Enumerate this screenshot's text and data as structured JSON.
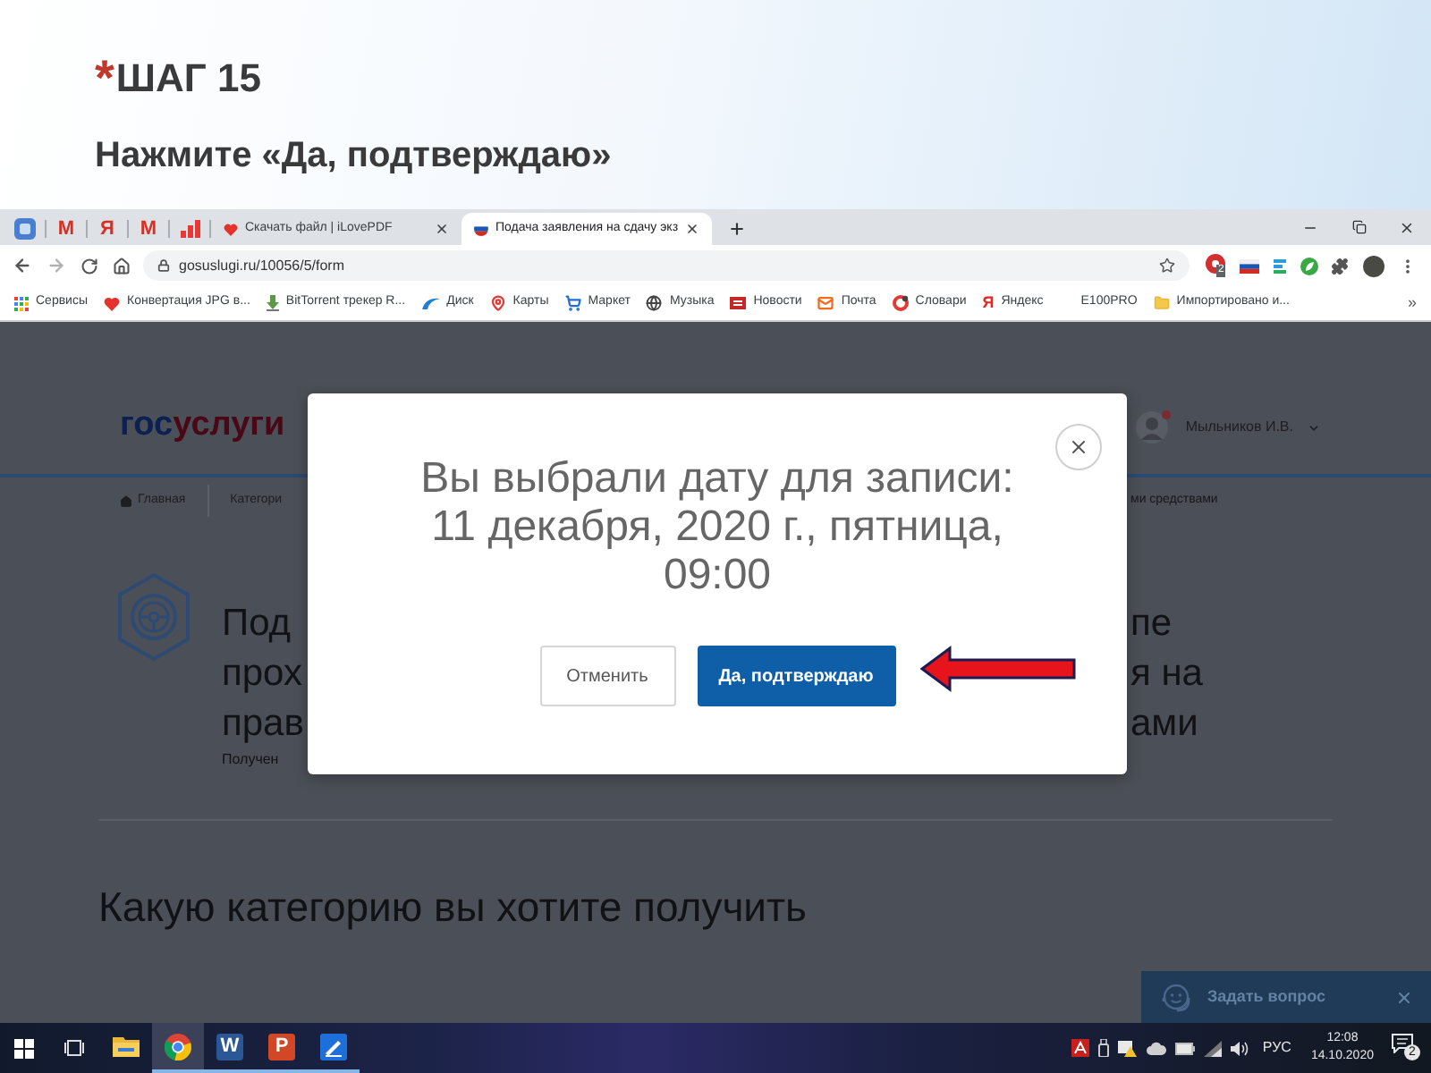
{
  "slide": {
    "marker": "*",
    "title": "ШАГ 15",
    "instruction": "Нажмите «Да, подтверждаю»"
  },
  "browser": {
    "pinned_tabs": [
      {
        "kind": "app"
      },
      {
        "kind": "glyph",
        "glyph": "M"
      },
      {
        "kind": "glyph",
        "glyph": "Я"
      },
      {
        "kind": "glyph",
        "glyph": "M"
      },
      {
        "kind": "chart"
      }
    ],
    "tabs": [
      {
        "kind": "heart",
        "title": "Скачать файл | iLovePDF",
        "selected": false
      },
      {
        "kind": "flag",
        "title": "Подача заявления на сдачу экз",
        "selected": true
      }
    ],
    "address": "gosuslugi.ru/10056/5/form",
    "extension_badge": "2",
    "bookmarks": [
      {
        "kind": "apps",
        "label": "Сервисы"
      },
      {
        "kind": "heart",
        "label": "Конвертация JPG в..."
      },
      {
        "kind": "torrent",
        "label": "BitTorrent трекер R..."
      },
      {
        "kind": "arc",
        "label": "Диск"
      },
      {
        "kind": "pin",
        "label": "Карты"
      },
      {
        "kind": "cart",
        "label": "Маркет"
      },
      {
        "kind": "globe",
        "label": "Музыка"
      },
      {
        "kind": "news",
        "label": "Новости"
      },
      {
        "kind": "mail",
        "label": "Почта"
      },
      {
        "kind": "round",
        "label": "Словари"
      },
      {
        "kind": "letter",
        "glyph": "Я",
        "label": "Яндекс"
      },
      {
        "kind": "blank",
        "label": "E100PRO"
      },
      {
        "kind": "folder",
        "label": "Импортировано и..."
      }
    ],
    "bookmarks_more": "»"
  },
  "page": {
    "logo": [
      {
        "text": "гос",
        "color": "#0c2152"
      },
      {
        "text": "услуги",
        "color": "#4a0816"
      }
    ],
    "user": "Мыльников И.В.",
    "breadcrumbs": [
      {
        "kind": "home",
        "label": "Главная"
      },
      {
        "kind": "plain",
        "label": "Категори"
      }
    ],
    "breadcrumb_tail": "ми средствами",
    "title_left": [
      "Под",
      "прох",
      "прав"
    ],
    "title_right": [
      "пе",
      "я на",
      "ами"
    ],
    "subtitle_left": "Получен",
    "section_heading": "Какую категорию вы хотите получить"
  },
  "modal": {
    "lines": [
      "Вы выбрали дату для записи:",
      "11 декабря, 2020 г., пятница,",
      "09:00"
    ],
    "buttons": [
      {
        "kind": "secondary",
        "label": "Отменить"
      },
      {
        "kind": "primary",
        "label": "Да, подтверждаю"
      }
    ]
  },
  "chat": {
    "label": "Задать вопрос"
  },
  "taskbar": {
    "apps": [
      {
        "kind": "folder",
        "selected": false,
        "running": false
      },
      {
        "kind": "browser",
        "selected": true,
        "running": true
      },
      {
        "kind": "tile",
        "glyph": "W",
        "color": "#2b5797",
        "selected": false,
        "running": true
      },
      {
        "kind": "tile",
        "glyph": "P",
        "color": "#d24726",
        "selected": false,
        "running": true
      },
      {
        "kind": "pen",
        "selected": false,
        "running": true
      }
    ],
    "tray": {
      "language": "РУС",
      "time": "12:08",
      "date": "14.10.2020",
      "notifications": "2"
    }
  }
}
